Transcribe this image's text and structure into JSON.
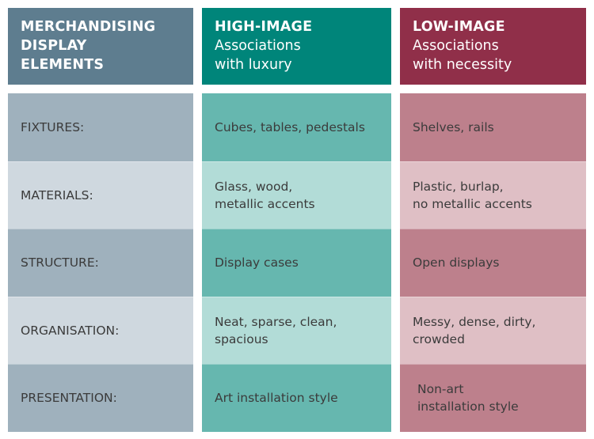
{
  "columns": [
    {
      "header_title": "MERCHANDISING\nDISPLAY\nELEMENTS",
      "header_sub": "",
      "color": "#5e7d8f",
      "cells": [
        "FIXTURES:",
        "MATERIALS:",
        "STRUCTURE:",
        "ORGANISATION:",
        "PRESENTATION:"
      ]
    },
    {
      "header_title": "HIGH-IMAGE",
      "header_sub": "Associations\nwith luxury",
      "color": "#00857a",
      "cells": [
        "Cubes, tables, pedestals",
        "Glass, wood,\nmetallic accents",
        "Display cases",
        "Neat, sparse, clean,\nspacious",
        "Art installation style"
      ]
    },
    {
      "header_title": "LOW-IMAGE",
      "header_sub": "Associations\nwith necessity",
      "color": "#902f49",
      "cells": [
        "Shelves, rails",
        "Plastic, burlap,\nno metallic accents",
        "Open displays",
        "Messy, dense, dirty,\ncrowded",
        "Non-art\ninstallation style"
      ]
    }
  ]
}
